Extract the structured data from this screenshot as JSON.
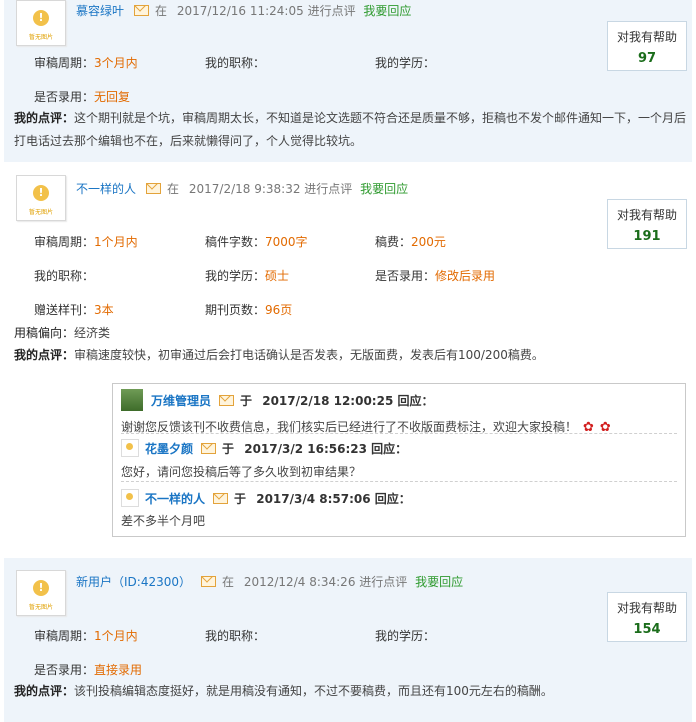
{
  "avatar_caption": "暂无图片",
  "common": {
    "at": "在",
    "review_action": "进行点评",
    "reply_link": "我要回应",
    "help_label": "对我有帮助",
    "comment_label": "我的点评："
  },
  "r1": {
    "user": "慕容绿叶",
    "time": "2017/12/16 11:24:05",
    "help": "97",
    "fields": [
      {
        "label": "审稿周期：",
        "value": "3个月内"
      },
      {
        "label": "我的职称：",
        "value": ""
      },
      {
        "label": "我的学历：",
        "value": ""
      },
      {
        "label": "是否录用：",
        "value": "无回复"
      }
    ],
    "comment_line1": "这个期刊就是个坑，审稿周期太长，不知道是论文选题不符合还是质量不够，拒稿也不发个邮件通知一下，一个月后",
    "comment_line2": "打电话过去那个编辑也不在，后来就懒得问了，个人觉得比较坑。"
  },
  "r2": {
    "user": "不一样的人",
    "time": "2017/2/18 9:38:32",
    "help": "191",
    "fields": [
      {
        "label": "审稿周期：",
        "value": "1个月内"
      },
      {
        "label": "稿件字数：",
        "value": "7000字"
      },
      {
        "label": "稿费：",
        "value": "200元"
      },
      {
        "label": "我的职称：",
        "value": ""
      },
      {
        "label": "我的学历：",
        "value": "硕士"
      },
      {
        "label": "是否录用：",
        "value": "修改后录用"
      },
      {
        "label": "赠送样刊：",
        "value": "3本"
      },
      {
        "label": "期刊页数：",
        "value": "96页"
      }
    ],
    "preference_label": "用稿偏向：",
    "preference_value": "经济类",
    "comment": "审稿速度较快，初审通过后会打电话确认是否发表，无版面费，发表后有100/200稿费。",
    "replies": [
      {
        "name": "万维管理员",
        "yu": "于",
        "time": "2017/2/18 12:00:25",
        "action": "回应：",
        "text": "谢谢您反馈该刊不收费信息，我们核实后已经进行了不收版面费标注，欢迎大家投稿！"
      },
      {
        "name": "花墨夕颜",
        "yu": "于",
        "time": "2017/3/2 16:56:23",
        "action": "回应：",
        "text": "您好，请问您投稿后等了多久收到初审结果？"
      },
      {
        "name": "不一样的人",
        "yu": "于",
        "time": "2017/3/4 8:57:06",
        "action": "回应：",
        "text": "差不多半个月吧"
      }
    ]
  },
  "r3": {
    "user": "新用户（ID:42300）",
    "time": "2012/12/4 8:34:26",
    "help": "154",
    "fields": [
      {
        "label": "审稿周期：",
        "value": "1个月内"
      },
      {
        "label": "我的职称：",
        "value": ""
      },
      {
        "label": "我的学历：",
        "value": ""
      },
      {
        "label": "是否录用：",
        "value": "直接录用"
      }
    ],
    "comment": "该刊投稿编辑态度挺好，就是用稿没有通知，不过不要稿费，而且还有100元左右的稿酬。"
  }
}
